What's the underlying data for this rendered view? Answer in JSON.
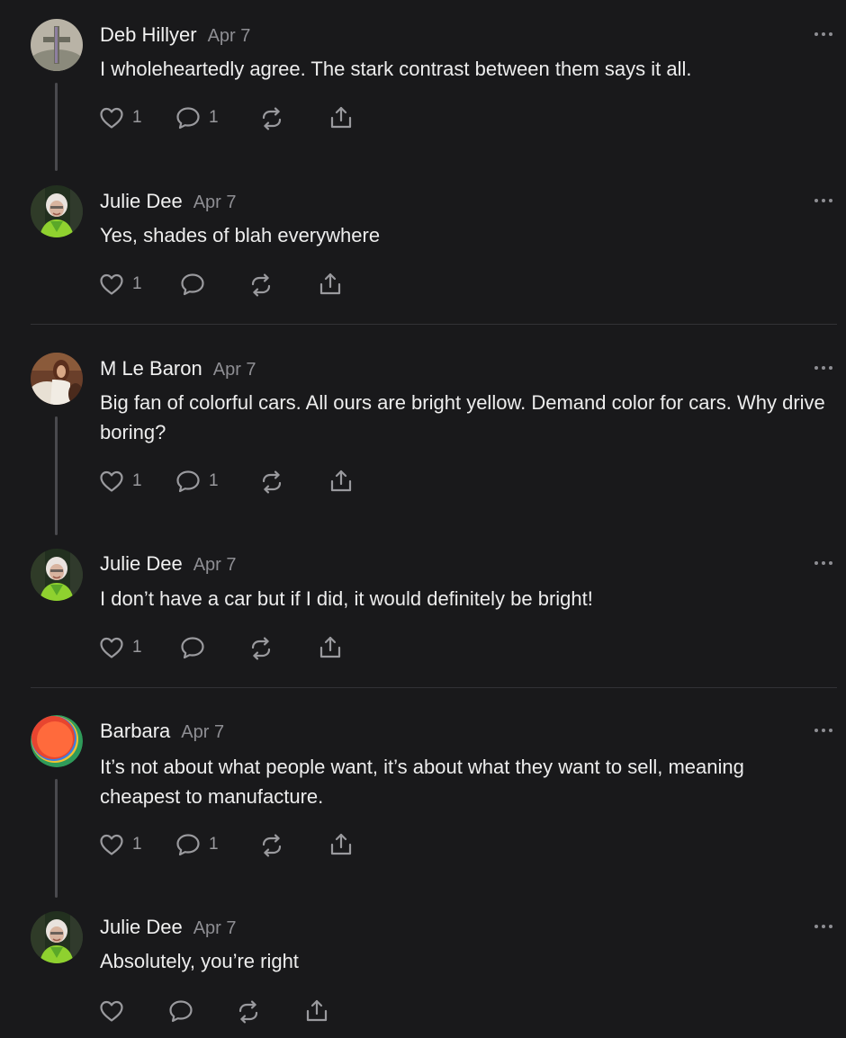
{
  "comments": [
    {
      "author": "Deb Hillyer",
      "date": "Apr 7",
      "text": "I wholeheartedly agree. The stark contrast between them says it all.",
      "likes": "1",
      "replies": "1",
      "avatar_colors": [
        "#b9b3a6",
        "#8b8a7c",
        "#6b6a5e"
      ]
    },
    {
      "author": "Julie Dee",
      "date": "Apr 7",
      "text": "Yes, shades of blah everywhere",
      "likes": "1",
      "replies": ""
    },
    {
      "author": "M Le Baron",
      "date": "Apr 7",
      "text": "Big fan of colorful cars. All ours are bright yellow. Demand color for cars. Why drive boring?",
      "likes": "1",
      "replies": "1"
    },
    {
      "author": "Julie Dee",
      "date": "Apr 7",
      "text": "I don’t have a car but if I did, it would definitely be bright!",
      "likes": "1",
      "replies": ""
    },
    {
      "author": "Barbara",
      "date": "Apr 7",
      "text": "It’s not about what people want, it’s about what they want to sell, meaning cheapest to manufacture.",
      "likes": "1",
      "replies": "1"
    },
    {
      "author": "Julie Dee",
      "date": "Apr 7",
      "text": "Absolutely, you’re right",
      "likes": "",
      "replies": ""
    }
  ],
  "icons": {
    "like": "heart-icon",
    "reply": "comment-bubble-icon",
    "restack": "restack-icon",
    "share": "share-icon",
    "more": "more-icon"
  },
  "colors": {
    "background": "#19191b",
    "text": "#ececec",
    "muted": "#8e8e93",
    "thread_line": "#4a4a4e",
    "divider": "#323236"
  }
}
